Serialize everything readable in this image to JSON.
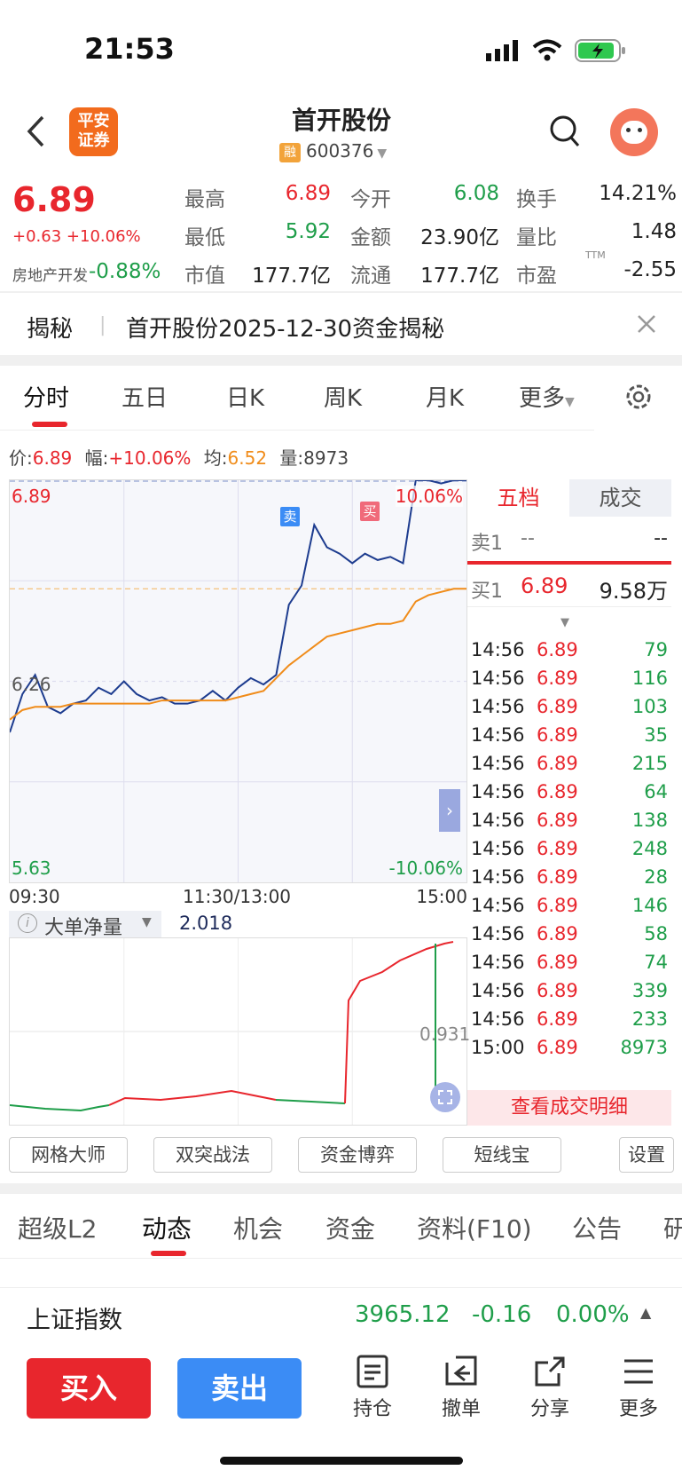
{
  "status_bar": {
    "time": "21:53"
  },
  "header": {
    "title": "首开股份",
    "rong": "融",
    "code": "600376",
    "logo_line1": "平安",
    "logo_line2": "证券"
  },
  "quote": {
    "price": "6.89",
    "change": "+0.63",
    "change_pct": "+10.06%",
    "sector_name": "房地产开发",
    "sector_pct": "-0.88%",
    "high_label": "最高",
    "high": "6.89",
    "open_label": "今开",
    "open": "6.08",
    "turnover_label": "换手",
    "turnover": "14.21%",
    "low_label": "最低",
    "low": "5.92",
    "amount_label": "金额",
    "amount": "23.90亿",
    "vol_ratio_label": "量比",
    "vol_ratio": "1.48",
    "mktcap_label": "市值",
    "mktcap": "177.7亿",
    "float_label": "流通",
    "float": "177.7亿",
    "pe_label": "市盈",
    "pe_sup": "TTM",
    "pe": "-2.55"
  },
  "reveal": {
    "tag": "揭秘",
    "text": "首开股份2025-12-30资金揭秘"
  },
  "chart_tabs": [
    "分时",
    "五日",
    "日K",
    "周K",
    "月K",
    "更多"
  ],
  "info_line": {
    "price_label": "价:",
    "price": "6.89",
    "amp_label": "幅:",
    "amp": "+10.06%",
    "avg_label": "均:",
    "avg": "6.52",
    "vol_label": "量:",
    "vol": "8973"
  },
  "chart_data": {
    "type": "line",
    "ylim": [
      5.63,
      6.89
    ],
    "y_top_label": "6.89",
    "y_mid_label": "6.26",
    "y_bottom_label": "5.63",
    "pct_top": "10.06%",
    "pct_bottom": "-10.06%",
    "x_labels": [
      "09:30",
      "11:30/13:00",
      "15:00"
    ],
    "markers": [
      "卖",
      "买"
    ],
    "series": [
      {
        "values": [
          6.1,
          6.22,
          6.28,
          6.18,
          6.16,
          6.19,
          6.2,
          6.24,
          6.22,
          6.26,
          6.22,
          6.2,
          6.21,
          6.19,
          6.19,
          6.2,
          6.23,
          6.2,
          6.24,
          6.27,
          6.25,
          6.28,
          6.5,
          6.56,
          6.75,
          6.68,
          6.66,
          6.63,
          6.66,
          6.64,
          6.65,
          6.63,
          6.89,
          6.89,
          6.88,
          6.89,
          6.89
        ]
      },
      {
        "values": [
          6.14,
          6.17,
          6.18,
          6.18,
          6.18,
          6.19,
          6.19,
          6.19,
          6.19,
          6.19,
          6.19,
          6.19,
          6.2,
          6.2,
          6.2,
          6.2,
          6.2,
          6.2,
          6.21,
          6.22,
          6.23,
          6.27,
          6.31,
          6.34,
          6.37,
          6.4,
          6.41,
          6.42,
          6.43,
          6.44,
          6.44,
          6.45,
          6.51,
          6.53,
          6.54,
          6.55,
          6.55
        ]
      }
    ]
  },
  "flow_chart": {
    "label": "大单净量",
    "value": "2.018",
    "mid_value": "0.931"
  },
  "side_tabs": [
    "五档",
    "成交"
  ],
  "order_book": {
    "sell1_label": "卖1",
    "sell1_price": "--",
    "sell1_vol": "--",
    "buy1_label": "买1",
    "buy1_price": "6.89",
    "buy1_vol": "9.58万"
  },
  "ticks": [
    {
      "time": "14:56",
      "price": "6.89",
      "vol": "79"
    },
    {
      "time": "14:56",
      "price": "6.89",
      "vol": "116"
    },
    {
      "time": "14:56",
      "price": "6.89",
      "vol": "103"
    },
    {
      "time": "14:56",
      "price": "6.89",
      "vol": "35"
    },
    {
      "time": "14:56",
      "price": "6.89",
      "vol": "215"
    },
    {
      "time": "14:56",
      "price": "6.89",
      "vol": "64"
    },
    {
      "time": "14:56",
      "price": "6.89",
      "vol": "138"
    },
    {
      "time": "14:56",
      "price": "6.89",
      "vol": "248"
    },
    {
      "time": "14:56",
      "price": "6.89",
      "vol": "28"
    },
    {
      "time": "14:56",
      "price": "6.89",
      "vol": "146"
    },
    {
      "time": "14:56",
      "price": "6.89",
      "vol": "58"
    },
    {
      "time": "14:56",
      "price": "6.89",
      "vol": "74"
    },
    {
      "time": "14:56",
      "price": "6.89",
      "vol": "339"
    },
    {
      "time": "14:56",
      "price": "6.89",
      "vol": "233"
    },
    {
      "time": "15:00",
      "price": "6.89",
      "vol": "8973"
    }
  ],
  "view_detail": "查看成交明细",
  "tools": [
    "网格大师",
    "双突战法",
    "资金博弈",
    "短线宝",
    "设置"
  ],
  "bottom_tabs": [
    "超级L2",
    "动态",
    "机会",
    "资金",
    "资料(F10)",
    "公告",
    "研"
  ],
  "index_bar": {
    "name": "上证指数",
    "value": "3965.12",
    "change": "-0.16",
    "pct": "0.00%"
  },
  "actions": {
    "buy": "买入",
    "sell": "卖出",
    "hold": "持仓",
    "cancel": "撤单",
    "share": "分享",
    "more": "更多"
  },
  "colors": {
    "up": "#e8262d",
    "down": "#1f9e4a",
    "price_line": "#1d3c8f",
    "avg_line": "#f08c1a",
    "buy_button": "#e8262d",
    "sell_button": "#3b8cf5"
  }
}
